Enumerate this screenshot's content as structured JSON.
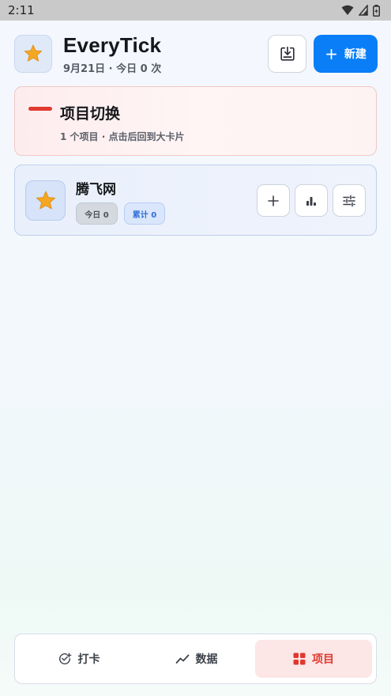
{
  "status_bar": {
    "time": "2:11"
  },
  "header": {
    "app_title": "EveryTick",
    "subtitle": "9月21日 · 今日 0 次",
    "new_button_label": "新建"
  },
  "switch_card": {
    "title": "项目切换",
    "subtitle": "1 个项目 · 点击后回到大卡片"
  },
  "projects": [
    {
      "name": "腾飞网",
      "today_badge": "今日 0",
      "total_badge": "累计 0"
    }
  ],
  "tabs": [
    {
      "label": "打卡",
      "icon": "check-add-icon",
      "active": false
    },
    {
      "label": "数据",
      "icon": "trend-icon",
      "active": false
    },
    {
      "label": "项目",
      "icon": "grid-icon",
      "active": true
    }
  ],
  "colors": {
    "accent_blue": "#0a7ef7",
    "accent_red": "#e23a2f",
    "star": "#f5a623"
  }
}
